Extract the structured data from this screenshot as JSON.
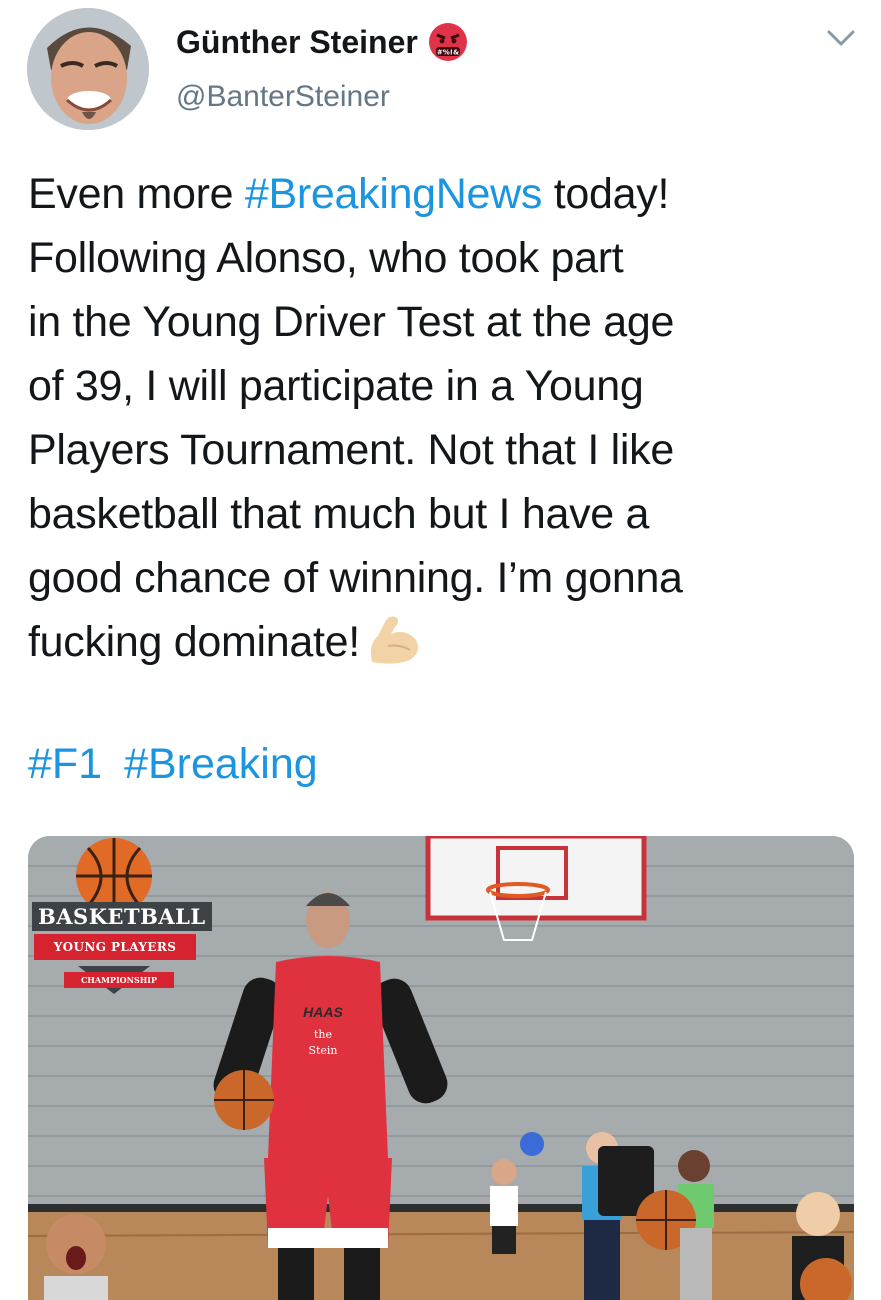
{
  "author": {
    "display_name": "Günther Steiner",
    "handle": "@BanterSteiner",
    "badge_icon": "angry-face-icon",
    "avatar": "avatar-photo"
  },
  "menu_icon": "chevron-down-icon",
  "tweet": {
    "lines": [
      [
        "Even more ",
        "#BreakingNews",
        " today!"
      ],
      [
        "Following Alonso, who took part"
      ],
      [
        "in the Young Driver Test at the age"
      ],
      [
        "of 39, I will participate in a Young"
      ],
      [
        "Players Tournament. Not that I like"
      ],
      [
        "basketball that much but I have a"
      ],
      [
        "good chance of winning. I’m gonna"
      ],
      [
        "fucking dominate!"
      ]
    ],
    "emoji_icon": "flexed-biceps-icon",
    "hashtags": [
      "#F1",
      "#Breaking"
    ]
  },
  "media": {
    "logo_title": "BASKETBALL",
    "logo_banner": "YOUNG PLAYERS",
    "logo_sub": "CHAMPIONSHIP",
    "jersey_brand": "HAAS",
    "jersey_the": "the",
    "jersey_name": "Stein"
  },
  "colors": {
    "link": "#1b95e0",
    "text": "#14171a",
    "secondary": "#657786",
    "jersey_red": "#d62330"
  }
}
